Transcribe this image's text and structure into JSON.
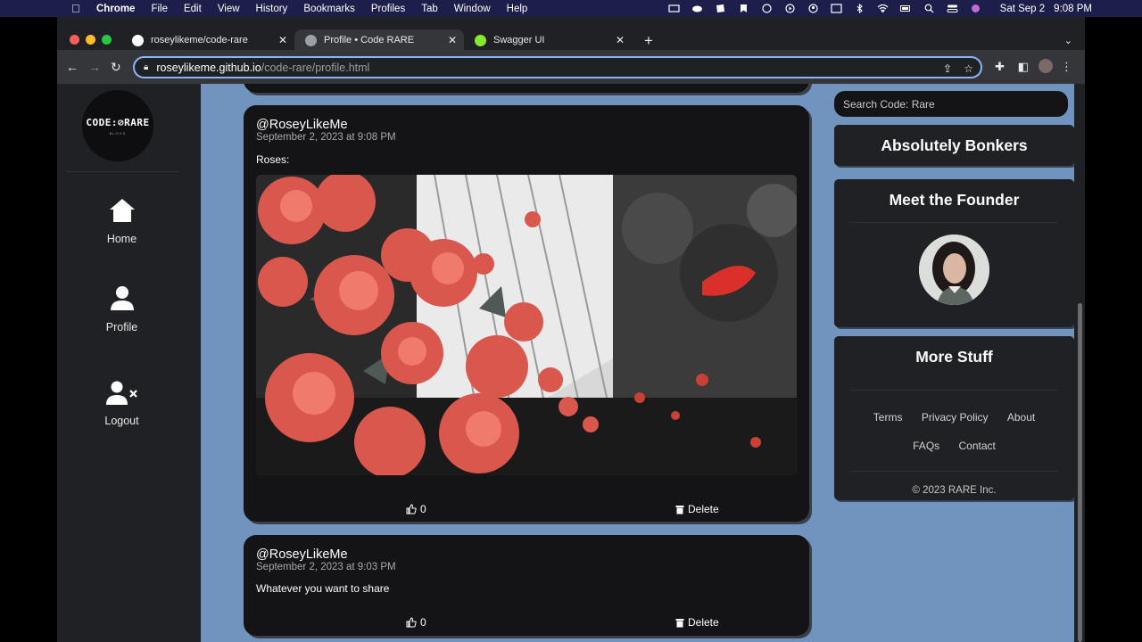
{
  "menubar": {
    "app": "Chrome",
    "items": [
      "File",
      "Edit",
      "View",
      "History",
      "Bookmarks",
      "Profiles",
      "Tab",
      "Window",
      "Help"
    ],
    "date": "Sat Sep 2",
    "time": "9:08 PM"
  },
  "browser": {
    "tabs": [
      {
        "title": "roseylikeme/code-rare",
        "active": false
      },
      {
        "title": "Profile • Code RARE",
        "active": true
      },
      {
        "title": "Swagger UI",
        "active": false
      }
    ],
    "url_host": "roseylikeme.github.io",
    "url_path": "/code-rare/profile.html"
  },
  "sidebar": {
    "logo_text": "CODE:⊘RARE",
    "logo_sub": "BLOGS",
    "items": [
      {
        "label": "Home",
        "icon": "home-icon"
      },
      {
        "label": "Profile",
        "icon": "user-icon"
      },
      {
        "label": "Logout",
        "icon": "user-x-icon"
      }
    ]
  },
  "posts": [
    {
      "handle": "@RoseyLikeMe",
      "date": "September 2, 2023 at 9:08 PM",
      "body": "Roses:",
      "has_image": true,
      "likes": "0",
      "delete_label": "Delete"
    },
    {
      "handle": "@RoseyLikeMe",
      "date": "September 2, 2023 at 9:03 PM",
      "body": "Whatever you want to share",
      "has_image": false,
      "likes": "0",
      "delete_label": "Delete"
    }
  ],
  "right": {
    "search_placeholder": "Search Code: Rare",
    "banner_title": "Absolutely Bonkers",
    "founder_title": "Meet the Founder",
    "more_title": "More Stuff",
    "links_row1": [
      "Terms",
      "Privacy Policy",
      "About"
    ],
    "links_row2": [
      "FAQs",
      "Contact"
    ],
    "copyright": "© 2023 RARE Inc."
  },
  "colors": {
    "page_background": "#7094be",
    "card_background": "#141416",
    "sidebar_background": "#202125",
    "accent_focus": "#8ab4f8"
  }
}
